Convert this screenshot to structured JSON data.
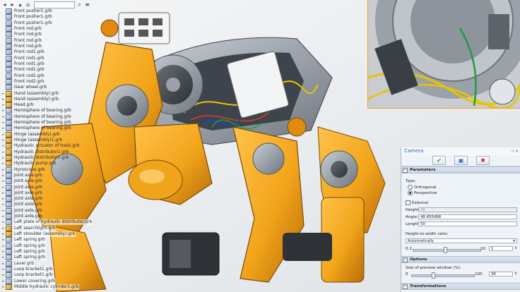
{
  "tree": {
    "items": [
      {
        "label": "Front pusher1.grb",
        "icon": "part",
        "expandable": false
      },
      {
        "label": "Front pusher1.grb",
        "icon": "part",
        "expandable": false
      },
      {
        "label": "Front pusher1.grb",
        "icon": "part",
        "expandable": false
      },
      {
        "label": "Front rod.grb",
        "icon": "part",
        "expandable": false
      },
      {
        "label": "Front rod.grb",
        "icon": "part",
        "expandable": false
      },
      {
        "label": "Front rod.grb",
        "icon": "part",
        "expandable": false
      },
      {
        "label": "Front rod.grb",
        "icon": "part",
        "expandable": false
      },
      {
        "label": "Front rod1.grb",
        "icon": "part",
        "expandable": false
      },
      {
        "label": "Front rod1.grb",
        "icon": "part",
        "expandable": false
      },
      {
        "label": "Front rod1.grb",
        "icon": "part",
        "expandable": false
      },
      {
        "label": "Front rod1.grb",
        "icon": "part",
        "expandable": false
      },
      {
        "label": "Front rod2.grb",
        "icon": "part",
        "expandable": false
      },
      {
        "label": "Front rod2.grb",
        "icon": "part",
        "expandable": false
      },
      {
        "label": "Gear wheel.grb",
        "icon": "part",
        "expandable": false
      },
      {
        "label": "Hand (assembly).grb",
        "icon": "asm",
        "expandable": true
      },
      {
        "label": "Hand (assembly).grb",
        "icon": "asm",
        "expandable": true
      },
      {
        "label": "Head.grb",
        "icon": "asm",
        "expandable": true
      },
      {
        "label": "Hemisphere of bearing.grb",
        "icon": "part",
        "expandable": true
      },
      {
        "label": "Hemisphere of bearing.grb",
        "icon": "part",
        "expandable": true
      },
      {
        "label": "Hemisphere of bearing.grb",
        "icon": "part",
        "expandable": true
      },
      {
        "label": "Hemisphere of bearing.grb",
        "icon": "part",
        "expandable": true
      },
      {
        "label": "Hinge (assembly).grb",
        "icon": "asm",
        "expandable": true
      },
      {
        "label": "Hinge (assembly)1.grb",
        "icon": "asm",
        "expandable": true
      },
      {
        "label": "Hydraulic actuator of track.grb",
        "icon": "asm",
        "expandable": true
      },
      {
        "label": "Hydraulic distributor1.grb",
        "icon": "asm",
        "expandable": true
      },
      {
        "label": "Hydraulic distributor1.grb",
        "icon": "asm",
        "expandable": true
      },
      {
        "label": "Hydraulic pump.grb",
        "icon": "asm",
        "expandable": true
      },
      {
        "label": "Hyroscope.grb",
        "icon": "part",
        "expandable": true
      },
      {
        "label": "Joint axle.grb",
        "icon": "part",
        "expandable": true
      },
      {
        "label": "Joint axle.grb",
        "icon": "part",
        "expandable": true
      },
      {
        "label": "Joint axle.grb",
        "icon": "part",
        "expandable": true
      },
      {
        "label": "Joint axle.grb",
        "icon": "part",
        "expandable": true
      },
      {
        "label": "Joint axle.grb",
        "icon": "part",
        "expandable": true
      },
      {
        "label": "Joint axle.grb",
        "icon": "part",
        "expandable": true
      },
      {
        "label": "Joint axle.grb",
        "icon": "part",
        "expandable": true
      },
      {
        "label": "Joint axle.grb",
        "icon": "part",
        "expandable": true
      },
      {
        "label": "Left plate of hydraulic distributor.grb",
        "icon": "part",
        "expandable": true
      },
      {
        "label": "Left searchlight.grb",
        "icon": "asm",
        "expandable": true
      },
      {
        "label": "Left shoulder (assembly).grb",
        "icon": "asm",
        "expandable": true
      },
      {
        "label": "Left spring.grb",
        "icon": "part",
        "expandable": true
      },
      {
        "label": "Left spring.grb",
        "icon": "part",
        "expandable": true
      },
      {
        "label": "Left spring.grb",
        "icon": "part",
        "expandable": true
      },
      {
        "label": "Left spring.grb",
        "icon": "part",
        "expandable": true
      },
      {
        "label": "Lever.grb",
        "icon": "part",
        "expandable": true
      },
      {
        "label": "Loop bracket1.grb",
        "icon": "part",
        "expandable": true
      },
      {
        "label": "Loop bracket1.grb",
        "icon": "part",
        "expandable": true
      },
      {
        "label": "Lower covering.grb",
        "icon": "part",
        "expandable": true
      },
      {
        "label": "Middle hydraulic cylinder1.grb",
        "icon": "asm",
        "expandable": true
      }
    ]
  },
  "camera": {
    "title": "Camera",
    "ok_icon": "check-icon",
    "preview_icon": "preview-icon",
    "cancel_icon": "cross-icon",
    "sections": {
      "parameters": "Parameters",
      "options": "Options",
      "transformations": "Transformations"
    },
    "type_label": "Type:",
    "orthogonal": "Orthogonal",
    "perspective": "Perspective",
    "external": "External",
    "height_label": "Height:",
    "height_value": "48",
    "angle_label": "Angle:",
    "angle_value": "48.455498",
    "length_label": "Length:",
    "length_value": "50",
    "ratio_label": "Height-to-width ratio:",
    "ratio_value": "Automatically",
    "ratio_min": "0.1",
    "ratio_max": "10",
    "ratio_field": "1",
    "size_label": "Size of preview window (%):",
    "size_min": "0",
    "size_max": "100",
    "size_field": "36"
  },
  "colors": {
    "accent": "#f0a020",
    "title": "#2c62b8",
    "robot": "#f2a51b"
  }
}
